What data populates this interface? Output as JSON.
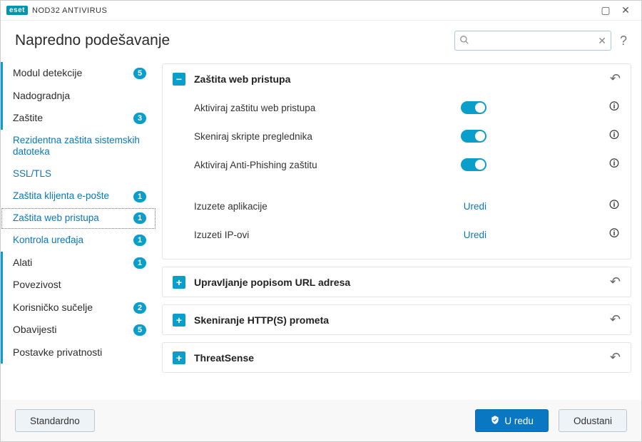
{
  "app": {
    "brand": "eset",
    "product": "NOD32 ANTIVIRUS"
  },
  "header": {
    "title": "Napredno podešavanje",
    "search_placeholder": ""
  },
  "sidebar": {
    "items": [
      {
        "label": "Modul detekcije",
        "badge": "5",
        "top": true
      },
      {
        "label": "Nadogradnja",
        "badge": null,
        "top": true
      },
      {
        "label": "Zaštite",
        "badge": "3",
        "top": true
      },
      {
        "label": "Rezidentna zaštita sistemskih datoteka",
        "badge": null,
        "sub": true
      },
      {
        "label": "SSL/TLS",
        "badge": null,
        "sub": true
      },
      {
        "label": "Zaštita klijenta e-pošte",
        "badge": "1",
        "sub": true
      },
      {
        "label": "Zaštita web pristupa",
        "badge": "1",
        "sub": true,
        "selected": true
      },
      {
        "label": "Kontrola uređaja",
        "badge": "1",
        "sub": true
      },
      {
        "label": "Alati",
        "badge": "1",
        "top": true
      },
      {
        "label": "Povezivost",
        "badge": null,
        "top": true
      },
      {
        "label": "Korisničko sučelje",
        "badge": "2",
        "top": true
      },
      {
        "label": "Obavijesti",
        "badge": "5",
        "top": true
      },
      {
        "label": "Postavke privatnosti",
        "badge": null,
        "top": true
      }
    ]
  },
  "panels": [
    {
      "title": "Zaštita web pristupa",
      "expanded": true,
      "rows": [
        {
          "label": "Aktiviraj zaštitu web pristupa",
          "type": "toggle",
          "value": true
        },
        {
          "label": "Skeniraj skripte preglednika",
          "type": "toggle",
          "value": true
        },
        {
          "label": "Aktiviraj Anti-Phishing zaštitu",
          "type": "toggle",
          "value": true
        }
      ],
      "links": [
        {
          "label": "Izuzete aplikacije",
          "action": "Uredi"
        },
        {
          "label": "Izuzeti IP-ovi",
          "action": "Uredi"
        }
      ]
    },
    {
      "title": "Upravljanje popisom URL adresa",
      "expanded": false
    },
    {
      "title": "Skeniranje HTTP(S) prometa",
      "expanded": false
    },
    {
      "title": "ThreatSense",
      "expanded": false
    }
  ],
  "footer": {
    "default_btn": "Standardno",
    "ok_btn": "U redu",
    "cancel_btn": "Odustani"
  }
}
